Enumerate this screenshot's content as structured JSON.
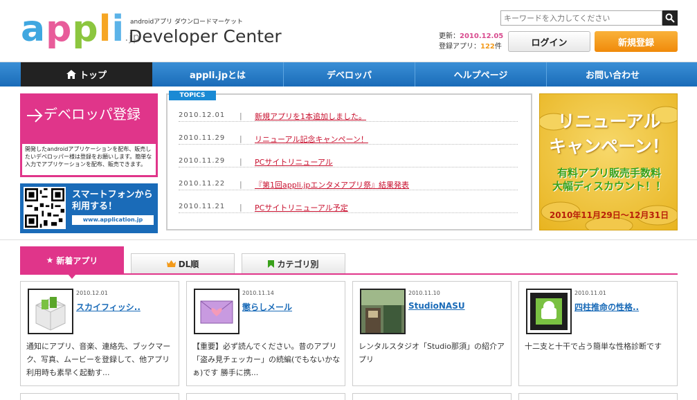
{
  "header": {
    "logo_parts": [
      "a",
      "p",
      "p",
      "l",
      "i"
    ],
    "logo_suffix": ".jp",
    "tagline": "androidアプリ ダウンロードマーケット",
    "dev_center": "Developer Center",
    "search_placeholder": "キーワードを入力してください",
    "updated_label": "更新：",
    "updated_value": "2010.12.05",
    "apps_label": "登録アプリ：",
    "apps_value": "122",
    "apps_unit": "件",
    "login_label": "ログイン",
    "signup_label": "新規登録"
  },
  "nav": {
    "items": [
      {
        "label": "トップ"
      },
      {
        "label": "appli.jpとは"
      },
      {
        "label": "デベロッパ"
      },
      {
        "label": "ヘルプページ"
      },
      {
        "label": "お問い合わせ"
      }
    ]
  },
  "dev_banner": {
    "title": "デベロッパ登録",
    "desc": "開発したandroidアプリケーションを配布、販売したいデベロッパー様は登録をお願いします。簡単な入力でアプリケーションを配布、販売できます。"
  },
  "sp_banner": {
    "title_line1": "スマートフォンから",
    "title_line2": "利用する！",
    "url": "www.application.jp"
  },
  "topics": {
    "label": "TOPICS",
    "items": [
      {
        "date": "2010.12.01",
        "text": "新規アプリを1本追加しました。"
      },
      {
        "date": "2010.11.29",
        "text": "リニューアル記念キャンペーン！"
      },
      {
        "date": "2010.11.29",
        "text": "PCサイトリニューアル"
      },
      {
        "date": "2010.11.22",
        "text": "『第1回appli.jpエンタメアプリ祭』結果発表"
      },
      {
        "date": "2010.11.21",
        "text": "PCサイトリニューアル予定"
      }
    ],
    "separator": "|"
  },
  "campaign": {
    "line1": "リニューアル",
    "line2": "キャンペーン！",
    "line3": "有料アプリ販売手数料",
    "line4": "大幅ディスカウント！！",
    "line5": "2010年11月29日～12月31日"
  },
  "tabs": [
    {
      "label": "新着アプリ"
    },
    {
      "label": "DL順"
    },
    {
      "label": "カテゴリ別"
    }
  ],
  "cards": [
    {
      "date": "2010.12.01",
      "title": "スカイフィッシ..",
      "desc": "通知にアプリ、音楽、連絡先、ブックマーク、写真、ムービーを登録して、他アプリ利用時も素早く起動す..."
    },
    {
      "date": "2010.11.14",
      "title": "懲らしメール",
      "desc": "【重要】必ず読んでください。昔のアプリ「盗み見チェッカー」の続編(でもないかなぁ)です 勝手に携..."
    },
    {
      "date": "2010.11.10",
      "title": "StudioNASU",
      "desc": "レンタルスタジオ「Studio那須」の紹介アプリ"
    },
    {
      "date": "2010.11.01",
      "title": "四柱推命の性格..",
      "desc": "十二支と十干で占う簡単な性格診断です"
    }
  ],
  "colors": {
    "nav_blue": "#1a6bb8",
    "pink": "#e0358a",
    "orange": "#f39a1a",
    "link_red": "#c8102e"
  }
}
